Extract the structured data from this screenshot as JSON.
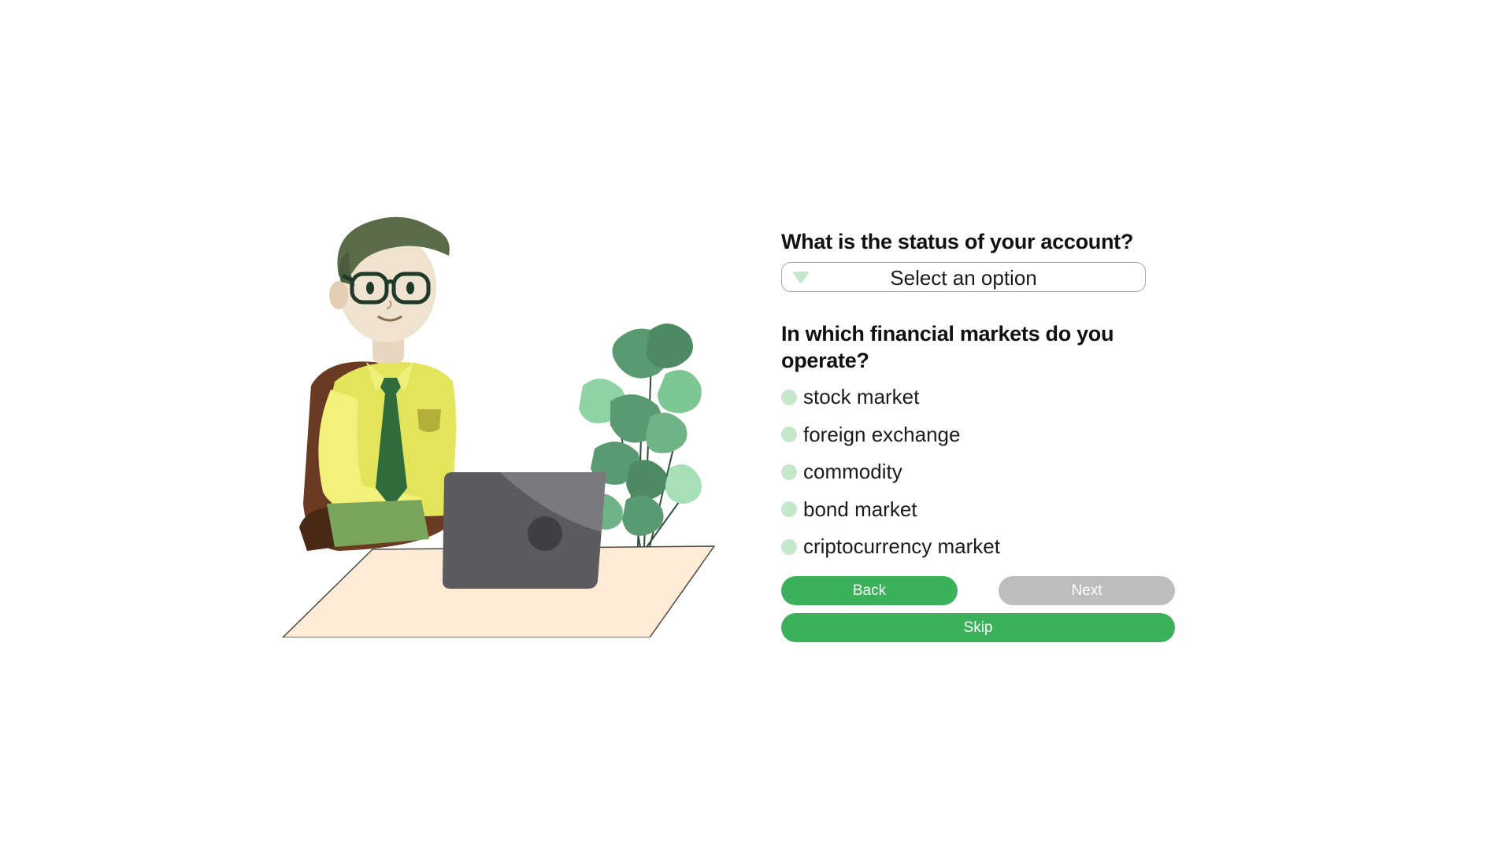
{
  "colors": {
    "accent": "#3cb15c",
    "disabled": "#bdbdbd",
    "radio": "#c5e7cc",
    "background": "#ffffff"
  },
  "illustration": {
    "name": "man-working-at-laptop-illustration"
  },
  "form": {
    "question1": "What is the status of your account?",
    "select": {
      "value": "Select an option",
      "icon": "chevron-down-icon"
    },
    "question2": "In which financial markets do you operate?",
    "options": [
      {
        "label": "stock market"
      },
      {
        "label": "foreign exchange"
      },
      {
        "label": "commodity"
      },
      {
        "label": "bond market"
      },
      {
        "label": "criptocurrency market"
      }
    ],
    "buttons": {
      "back": "Back",
      "next": "Next",
      "skip": "Skip"
    }
  }
}
